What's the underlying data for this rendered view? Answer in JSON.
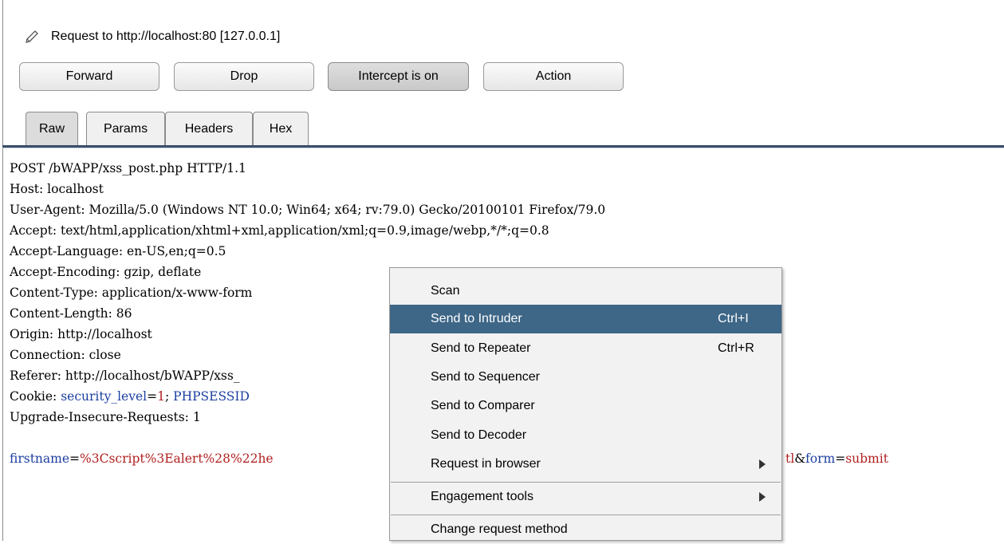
{
  "header": {
    "icon": "pencil-icon",
    "title": "Request to http://localhost:80  [127.0.0.1]"
  },
  "buttons": {
    "forward": "Forward",
    "drop": "Drop",
    "intercept": "Intercept is on",
    "action": "Action"
  },
  "tabs": [
    "Raw",
    "Params",
    "Headers",
    "Hex"
  ],
  "request": {
    "line1": "POST /bWAPP/xss_post.php HTTP/1.1",
    "line2": "Host: localhost",
    "line3": "User-Agent: Mozilla/5.0 (Windows NT 10.0; Win64; x64; rv:79.0) Gecko/20100101 Firefox/79.0",
    "line4": "Accept: text/html,application/xhtml+xml,application/xml;q=0.9,image/webp,*/*;q=0.8",
    "line5": "Accept-Language: en-US,en;q=0.5",
    "line6": "Accept-Encoding: gzip, deflate",
    "line7": "Content-Type: application/x-www-form",
    "line8": "Content-Length: 86",
    "line9": "Origin: http://localhost",
    "line10": "Connection: close",
    "line11": "Referer: http://localhost/bWAPP/xss_",
    "cookie_prefix": "Cookie: ",
    "cookie_key1": "security_level",
    "cookie_eq1": "=",
    "cookie_val1": "1",
    "cookie_sep": "; ",
    "cookie_key2": "PHPSESSID",
    "line13": "Upgrade-Insecure-Requests: 1",
    "body_key1": "firstname",
    "body_eq1": "=",
    "body_val1": "%3Cscript%3Ealert%28%22he",
    "body_tail_val": "tl",
    "body_amp": "&",
    "body_key2": "form",
    "body_eq2": "=",
    "body_val2": "submit"
  },
  "context_menu": {
    "scan": "Scan",
    "send_intruder": "Send to Intruder",
    "send_intruder_shortcut": "Ctrl+I",
    "send_repeater": "Send to Repeater",
    "send_repeater_shortcut": "Ctrl+R",
    "send_sequencer": "Send to Sequencer",
    "send_comparer": "Send to Comparer",
    "send_decoder": "Send to Decoder",
    "request_browser": "Request in browser",
    "engagement_tools": "Engagement tools",
    "change_method": "Change request method"
  },
  "colors": {
    "highlight": "#3d6687",
    "param_key": "#1c3fa0",
    "param_value": "#b02020"
  }
}
